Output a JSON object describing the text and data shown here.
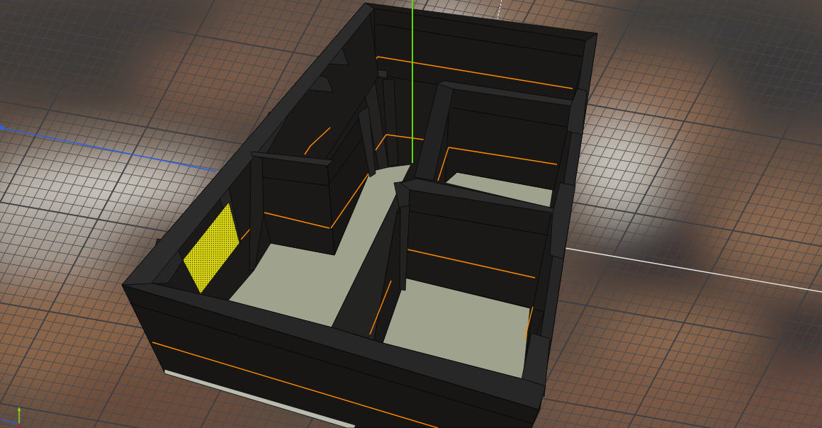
{
  "viewport": {
    "axis_lines": [
      {
        "kind": "solid",
        "color": "#2a62e0"
      },
      {
        "kind": "solid",
        "color": "#66d600"
      },
      {
        "kind": "solid",
        "color": "#e4e4e4"
      },
      {
        "kind": "dashed",
        "color": "#e4e4e4"
      }
    ],
    "model": {
      "wall_faces": [
        {
          "selected": false
        },
        {
          "selected": false
        },
        {
          "selected": true
        },
        {
          "selected": false
        },
        {
          "selected": false
        },
        {
          "selected": false
        },
        {
          "selected": false
        },
        {
          "selected": false
        }
      ]
    }
  }
}
